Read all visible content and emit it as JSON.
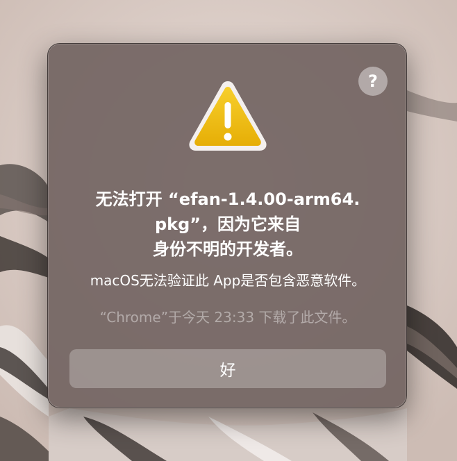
{
  "dialog": {
    "help_label": "?",
    "icon": "warning-triangle-icon",
    "title_lines": [
      "无法打开 “efan-1.4.00-arm64.",
      "pkg”，因为它来自",
      "身份不明的开发者。"
    ],
    "message": "macOS无法验证此 App是否包含恶意软件。",
    "download_info": "“Chrome”于今天 23:33 下载了此文件。",
    "ok_label": "好"
  },
  "colors": {
    "warning_yellow": "#f2c012",
    "dialog_bg": "#70625f",
    "background": "#d9ccc6"
  }
}
